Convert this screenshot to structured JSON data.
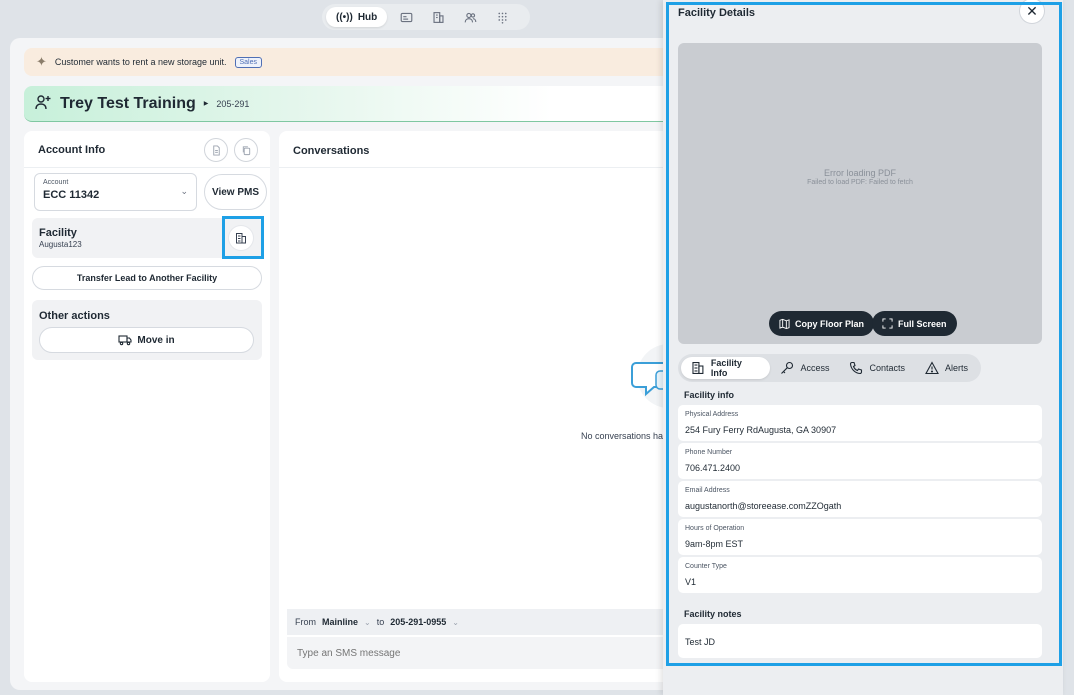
{
  "nav": {
    "hub_label": "Hub"
  },
  "banner": {
    "text": "Customer wants to rent a new storage unit.",
    "tag": "Sales"
  },
  "contact": {
    "name": "Trey Test Training",
    "number": "205-291"
  },
  "account_panel": {
    "title": "Account Info",
    "account_label": "Account",
    "account_value": "ECC 11342",
    "view_pms_label": "View PMS",
    "facility_title": "Facility",
    "facility_name": "Augusta123",
    "transfer_label": "Transfer Lead to Another Facility",
    "other_actions_title": "Other actions",
    "move_in_label": "Move in"
  },
  "conversations": {
    "title": "Conversations",
    "empty_text": "No conversations hav",
    "from_label": "From",
    "from_value": "Mainline",
    "to_label": "to",
    "to_value": "205-291-0955",
    "sms_placeholder": "Type an SMS message"
  },
  "drawer": {
    "title": "Facility Details",
    "pdf_error_title": "Error loading PDF",
    "pdf_error_detail": "Failed to load PDF: Failed to fetch",
    "copy_floor_plan_label": "Copy Floor Plan",
    "full_screen_label": "Full Screen",
    "tabs": [
      {
        "label": "Facility Info"
      },
      {
        "label": "Access"
      },
      {
        "label": "Contacts"
      },
      {
        "label": "Alerts"
      }
    ],
    "facility_info_heading": "Facility info",
    "info": [
      {
        "label": "Physical Address",
        "value": "254 Fury Ferry RdAugusta, GA 30907"
      },
      {
        "label": "Phone Number",
        "value": "706.471.2400"
      },
      {
        "label": "Email Address",
        "value": "augustanorth@storeease.comZZOgath"
      },
      {
        "label": "Hours of Operation",
        "value": "9am-8pm EST"
      },
      {
        "label": "Counter Type",
        "value": "V1"
      }
    ],
    "notes_heading": "Facility notes",
    "notes_value": "Test JD"
  },
  "colors": {
    "highlight": "#1ea0e6",
    "banner_bg": "#f9ecdf",
    "contact_green": "#c7f0da",
    "dark_button": "#1f2933"
  }
}
